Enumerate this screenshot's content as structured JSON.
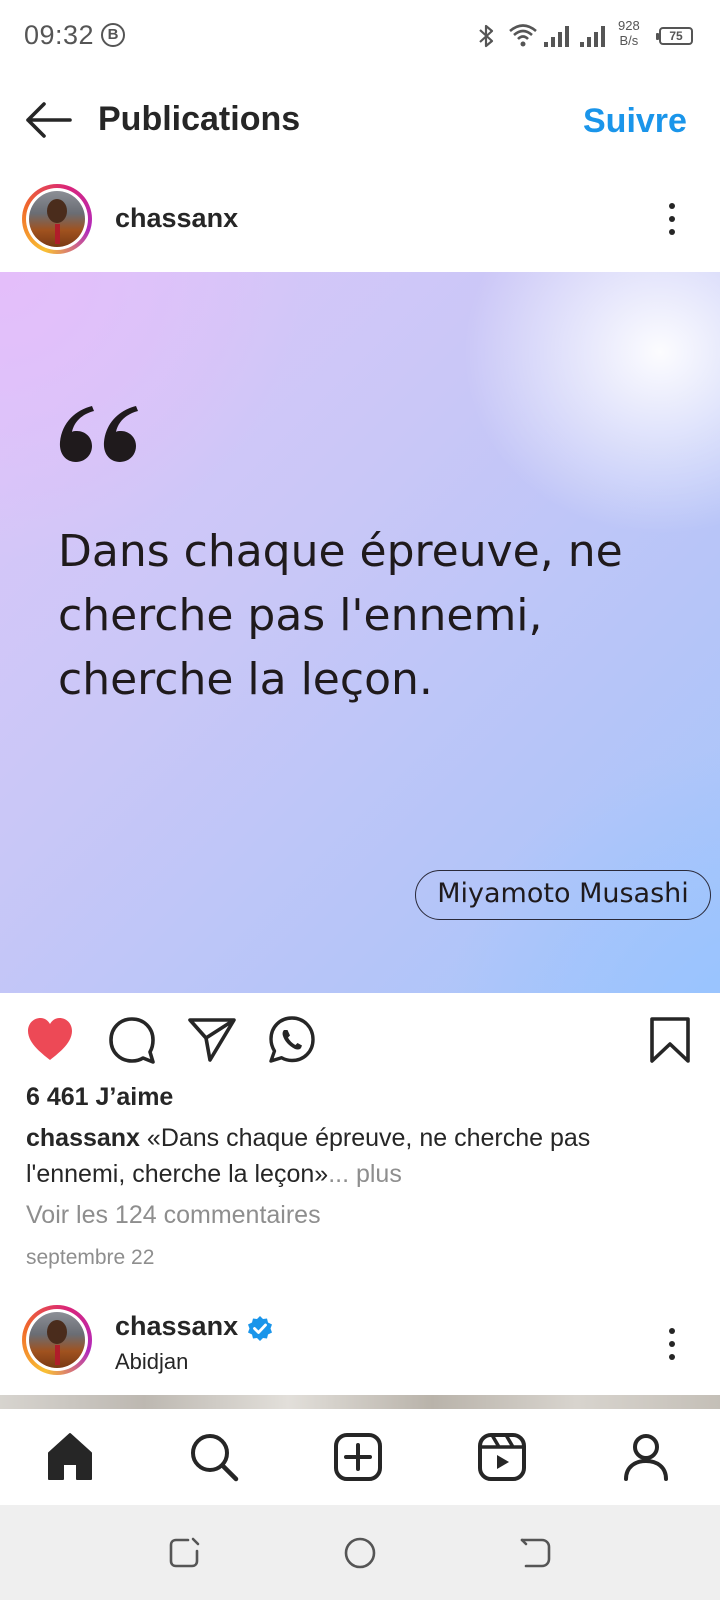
{
  "status_bar": {
    "time": "09:32",
    "b_badge": "B",
    "net_speed_value": "928",
    "net_speed_unit": "B/s",
    "battery": "75"
  },
  "header": {
    "title": "Publications",
    "follow_label": "Suivre",
    "back_icon": "arrow-left-icon"
  },
  "post": {
    "username": "chassanx",
    "quote_text": "Dans chaque épreuve, ne cherche pas l'ennemi, cherche la leçon.",
    "author": "Miyamoto Musashi",
    "liked": true,
    "like_color": "#ed4956",
    "likes": "6 461 J’aime",
    "caption_user": "chassanx",
    "caption_text": " «Dans chaque épreuve, ne cherche pas l'ennemi, cherche la leçon»",
    "caption_more": "... plus",
    "comments_link": "Voir les 124 commentaires",
    "date": "septembre 22"
  },
  "next_post": {
    "username": "chassanx",
    "verified": true,
    "verified_color": "#1a95ea",
    "location": "Abidjan"
  },
  "bottom_nav": {
    "items": [
      "home-icon",
      "search-icon",
      "create-icon",
      "reels-icon",
      "profile-icon"
    ]
  },
  "colors": {
    "accent": "#1a95ea",
    "text": "#262626",
    "muted": "#8e8e8e"
  }
}
